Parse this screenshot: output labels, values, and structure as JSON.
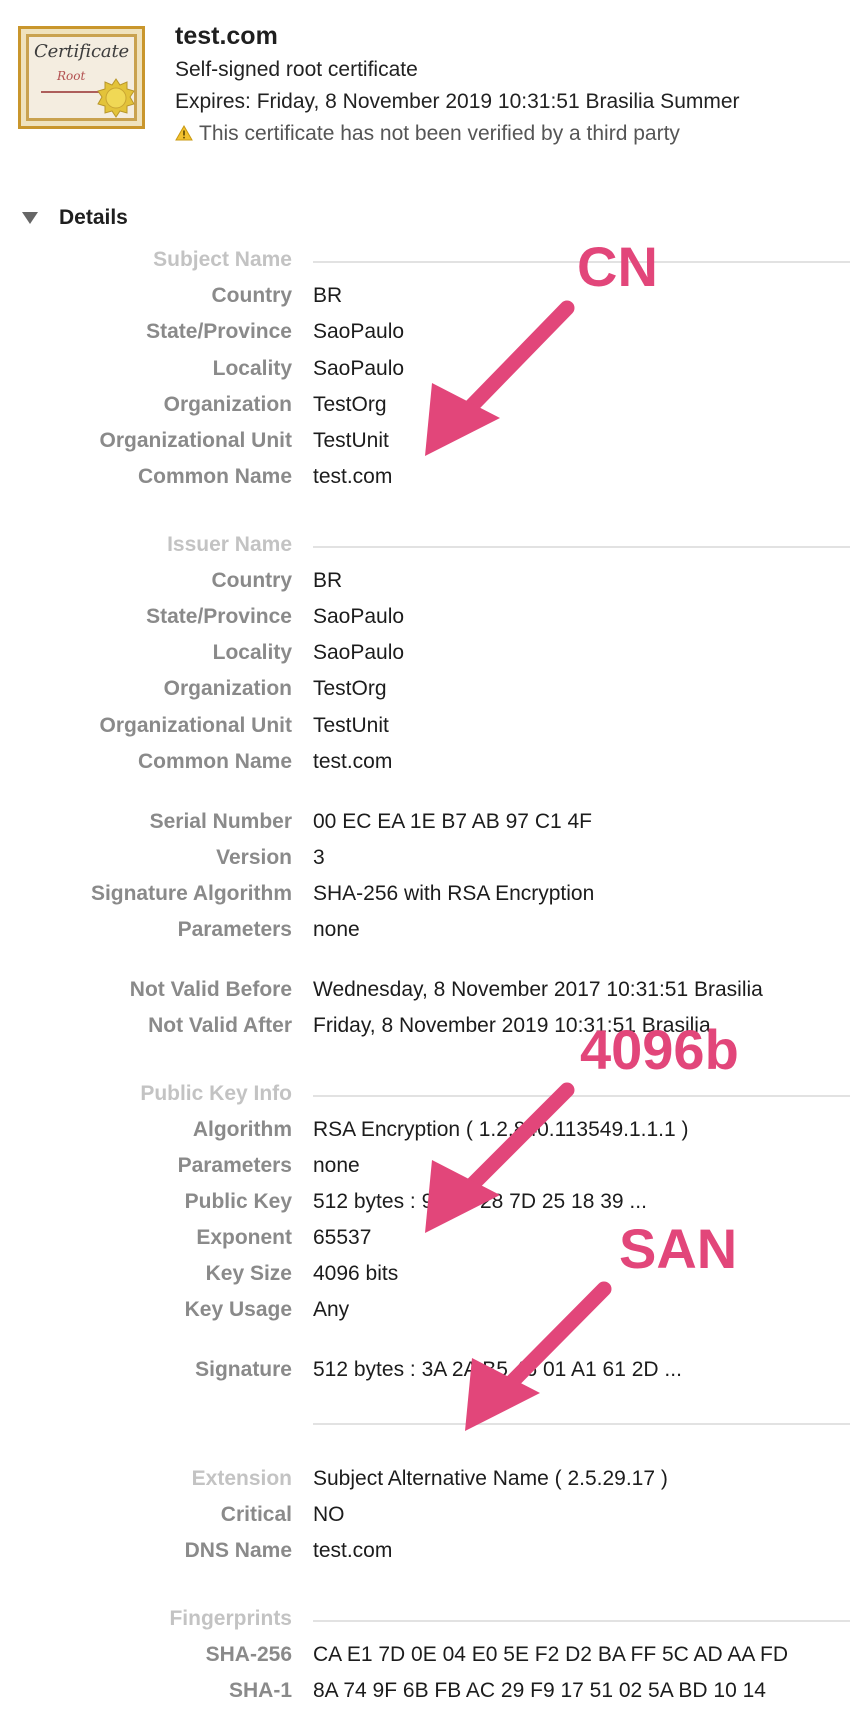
{
  "header": {
    "title": "test.com",
    "subtitle": "Self-signed root certificate",
    "expires": "Expires: Friday, 8 November 2019 10:31:51 Brasilia Summer",
    "warning": "This certificate has not been verified by a third party",
    "icon_name": "certificate-icon",
    "icon_text_main": "Certificate",
    "icon_text_sub": "Root"
  },
  "details": {
    "label": "Details",
    "expanded": true
  },
  "subject": {
    "section": "Subject Name",
    "rows": [
      {
        "key": "Country",
        "value": "BR"
      },
      {
        "key": "State/Province",
        "value": "SaoPaulo"
      },
      {
        "key": "Locality",
        "value": "SaoPaulo"
      },
      {
        "key": "Organization",
        "value": "TestOrg"
      },
      {
        "key": "Organizational Unit",
        "value": "TestUnit"
      },
      {
        "key": "Common Name",
        "value": "test.com"
      }
    ]
  },
  "issuer": {
    "section": "Issuer Name",
    "rows": [
      {
        "key": "Country",
        "value": "BR"
      },
      {
        "key": "State/Province",
        "value": "SaoPaulo"
      },
      {
        "key": "Locality",
        "value": "SaoPaulo"
      },
      {
        "key": "Organization",
        "value": "TestOrg"
      },
      {
        "key": "Organizational Unit",
        "value": "TestUnit"
      },
      {
        "key": "Common Name",
        "value": "test.com"
      }
    ]
  },
  "cert_info": {
    "rows": [
      {
        "key": "Serial Number",
        "value": "00 EC EA 1E B7 AB 97 C1 4F"
      },
      {
        "key": "Version",
        "value": "3"
      },
      {
        "key": "Signature Algorithm",
        "value": "SHA-256 with RSA Encryption"
      },
      {
        "key": "Parameters",
        "value": "none"
      }
    ]
  },
  "validity": {
    "rows": [
      {
        "key": "Not Valid Before",
        "value": "Wednesday, 8 November 2017 10:31:51 Brasilia"
      },
      {
        "key": "Not Valid After",
        "value": "Friday, 8 November 2019 10:31:51 Brasilia"
      }
    ]
  },
  "public_key": {
    "section": "Public Key Info",
    "rows": [
      {
        "key": "Algorithm",
        "value": "RSA Encryption ( 1.2.840.113549.1.1.1 )"
      },
      {
        "key": "Parameters",
        "value": "none"
      },
      {
        "key": "Public Key",
        "value": "512 bytes : 96 40 28 7D 25 18 39 ..."
      },
      {
        "key": "Exponent",
        "value": "65537"
      },
      {
        "key": "Key Size",
        "value": "4096 bits"
      },
      {
        "key": "Key Usage",
        "value": "Any"
      }
    ]
  },
  "signature": {
    "key": "Signature",
    "value": "512 bytes : 3A 2A B5 46 01 A1 61 2D ..."
  },
  "extension": {
    "rows": [
      {
        "key": "Extension",
        "value": "Subject Alternative Name ( 2.5.29.17 )"
      },
      {
        "key": "Critical",
        "value": "NO"
      },
      {
        "key": "DNS Name",
        "value": "test.com"
      }
    ]
  },
  "fingerprints": {
    "section": "Fingerprints",
    "rows": [
      {
        "key": "SHA-256",
        "value": "CA E1 7D 0E 04 E0 5E F2 D2 BA FF 5C AD AA FD"
      },
      {
        "key": "SHA-1",
        "value": "8A 74 9F 6B FB AC 29 F9 17 51 02 5A BD 10 14"
      }
    ]
  },
  "annotations": {
    "cn": "CN",
    "keysize": "4096b",
    "san": "SAN",
    "color": "#e2467a"
  }
}
